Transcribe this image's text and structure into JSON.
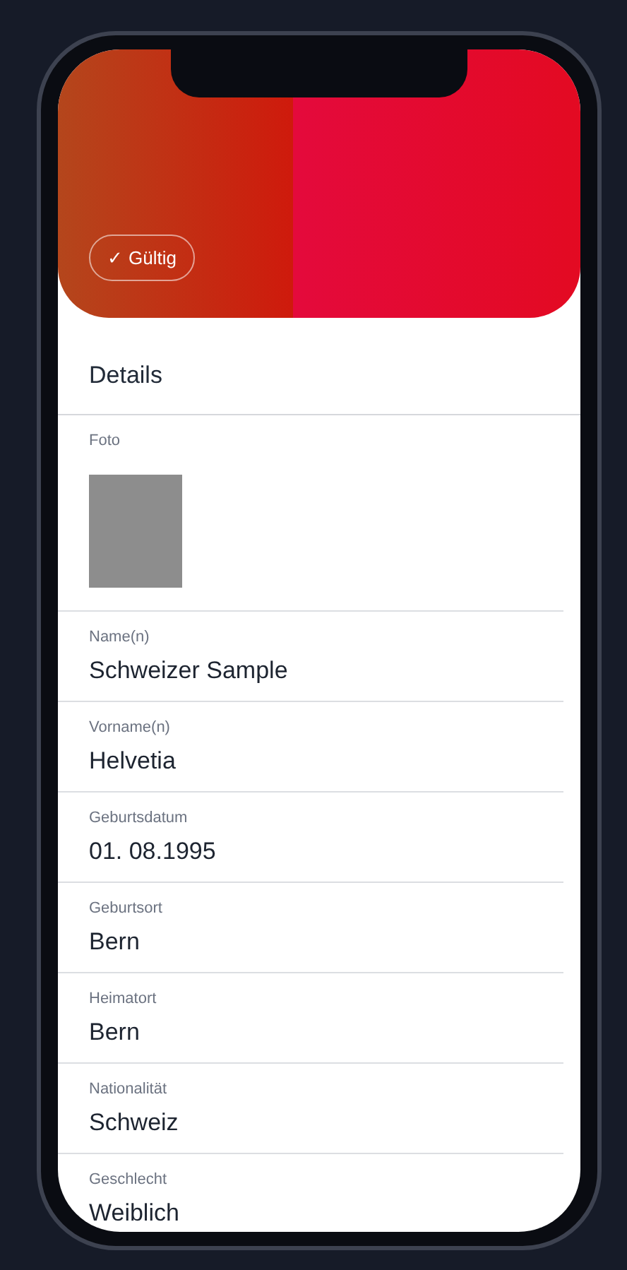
{
  "header": {
    "status_badge": {
      "icon": "✓",
      "label": "Gültig",
      "valid": true
    }
  },
  "section_title": "Details",
  "photo": {
    "label": "Foto"
  },
  "fields": [
    {
      "label": "Name(n)",
      "value": "Schweizer Sample"
    },
    {
      "label": "Vorname(n)",
      "value": "Helvetia"
    },
    {
      "label": "Geburtsdatum",
      "value": "01. 08.1995"
    },
    {
      "label": "Geburtsort",
      "value": "Bern"
    },
    {
      "label": "Heimatort",
      "value": "Bern"
    },
    {
      "label": "Nationalität",
      "value": "Schweiz"
    },
    {
      "label": "Geschlecht",
      "value": "Weiblich"
    }
  ]
}
